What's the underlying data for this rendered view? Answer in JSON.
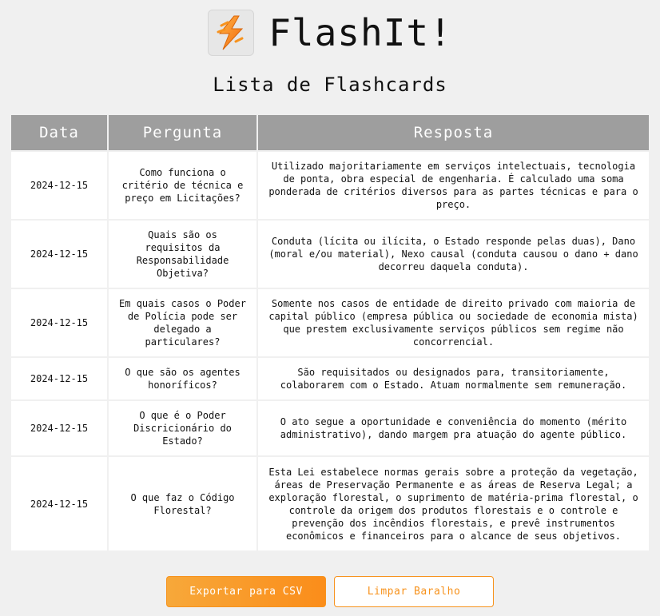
{
  "app": {
    "title": "FlashIt!",
    "logo_icon": "lightning-bolt-icon",
    "accent_color": "#f7931e"
  },
  "page": {
    "subtitle": "Lista de Flashcards"
  },
  "table": {
    "headers": {
      "date": "Data",
      "question": "Pergunta",
      "answer": "Resposta"
    },
    "rows": [
      {
        "date": "2024-12-15",
        "question": "Como funciona o critério de técnica e preço em Licitações?",
        "answer": "Utilizado majoritariamente em serviços intelectuais, tecnologia de ponta, obra especial de engenharia. É calculado uma soma ponderada de critérios diversos para as partes técnicas e para o preço."
      },
      {
        "date": "2024-12-15",
        "question": "Quais são os requisitos da Responsabilidade Objetiva?",
        "answer": "Conduta (lícita ou ilícita, o Estado responde pelas duas), Dano (moral e/ou material), Nexo causal (conduta causou o dano + dano decorreu daquela conduta)."
      },
      {
        "date": "2024-12-15",
        "question": "Em quais casos o Poder de Polícia pode ser delegado a particulares?",
        "answer": "Somente nos casos de entidade de direito privado com maioria de capital público (empresa pública ou sociedade de economia mista) que prestem exclusivamente serviços públicos sem regime não concorrencial."
      },
      {
        "date": "2024-12-15",
        "question": "O que são os agentes honoríficos?",
        "answer": "São requisitados ou designados para, transitoriamente, colaborarem com o Estado. Atuam normalmente sem remuneração."
      },
      {
        "date": "2024-12-15",
        "question": "O que é o Poder Discricionário do Estado?",
        "answer": "O ato segue a oportunidade e conveniência do momento (mérito administrativo), dando margem pra atuação do agente público."
      },
      {
        "date": "2024-12-15",
        "question": "O que faz o Código Florestal?",
        "answer": "Esta Lei estabelece normas gerais sobre a proteção da vegetação, áreas de Preservação Permanente e as áreas de Reserva Legal; a exploração florestal, o suprimento de matéria-prima florestal, o controle da origem dos produtos florestais e o controle e prevenção dos incêndios florestais, e prevê instrumentos econômicos e financeiros para o alcance de seus objetivos."
      }
    ]
  },
  "actions": {
    "export_label": "Exportar para CSV",
    "clear_label": "Limpar Baralho"
  }
}
